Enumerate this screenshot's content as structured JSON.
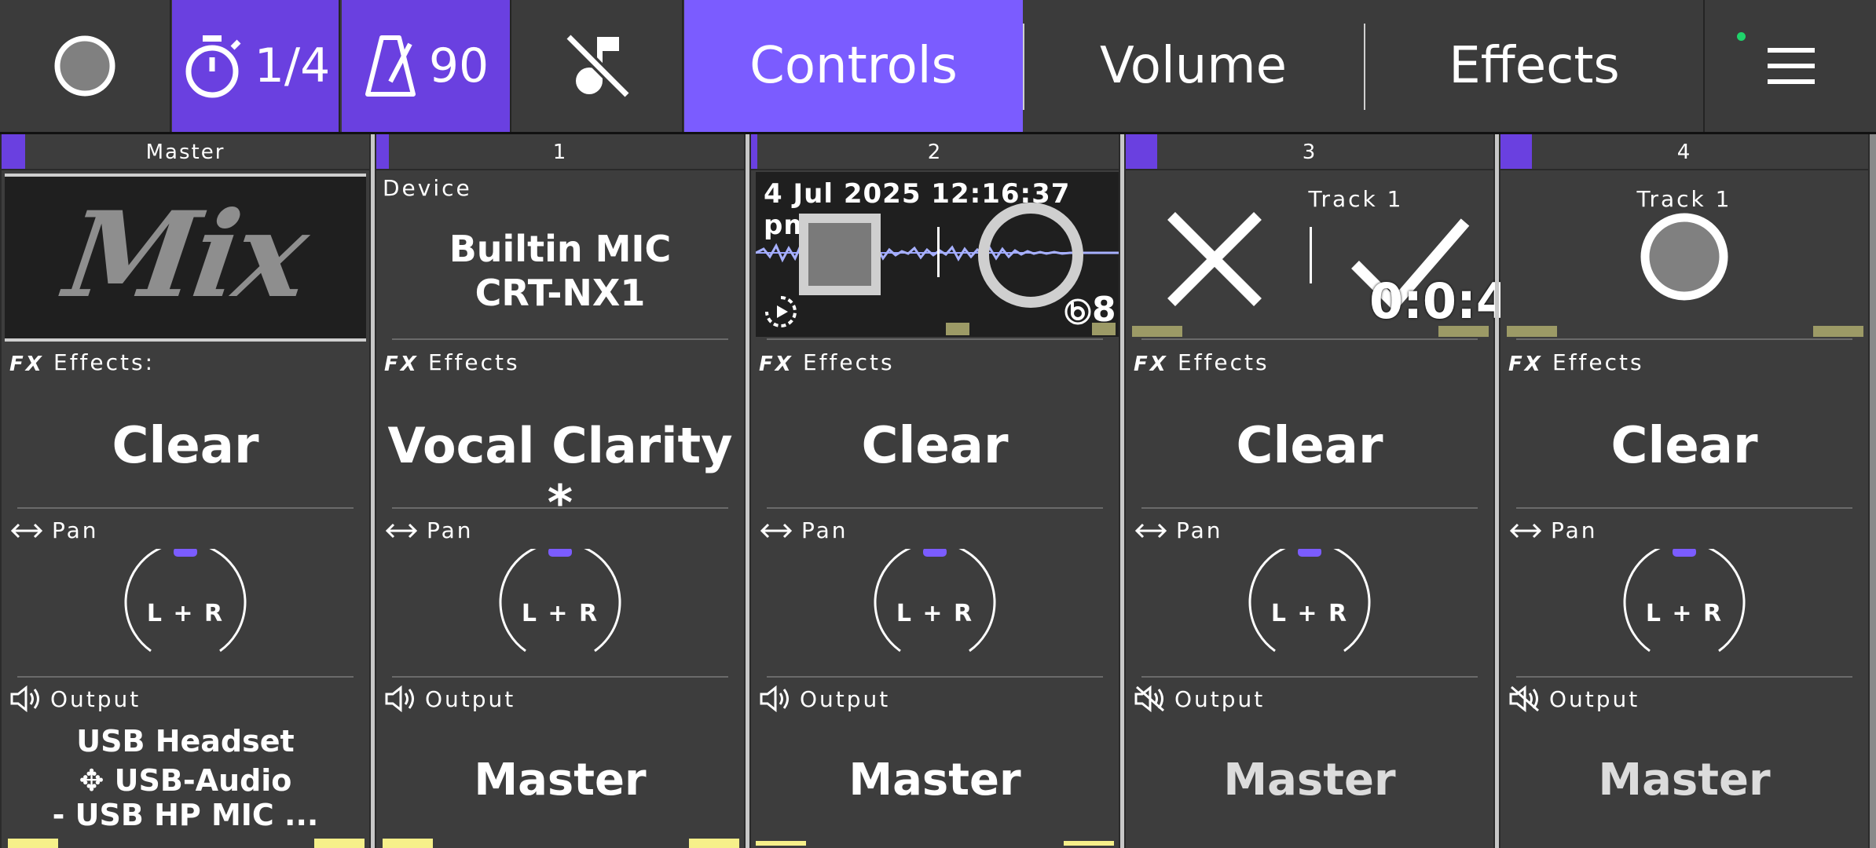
{
  "topbar": {
    "record_icon": "record-circle-icon",
    "timer_icon": "stopwatch-icon",
    "timer_value": "1/4",
    "metronome_icon": "metronome-icon",
    "tempo_value": "90",
    "mute_music_icon": "music-off-icon",
    "tabs": [
      {
        "label": "Controls"
      },
      {
        "label": "Volume"
      },
      {
        "label": "Effects"
      }
    ],
    "menu_icon": "hamburger-menu-icon",
    "status_dot_color": "#1fd36b"
  },
  "colors": {
    "accent": "#7b5cff",
    "accent_dark": "#6a40e0",
    "meter_yellow": "#f6f08a",
    "meter_olive": "#9c9a66",
    "knob_indicator": "#7b5cff"
  },
  "strips": [
    {
      "number": "Master",
      "top": {
        "type": "mix",
        "text": "Mix"
      },
      "effects_label": "Effects:",
      "effects_value": "Clear",
      "pan_label": "Pan",
      "pan_value": "L + R",
      "output_label": "Output",
      "output_lines": [
        "USB Headset",
        "✥ USB-Audio",
        "- USB HP MIC ..."
      ],
      "output_muted": false
    },
    {
      "number": "1",
      "top": {
        "type": "device",
        "caption": "Device",
        "line1": "Builtin MIC",
        "line2": "CRT-NX1"
      },
      "effects_label": "Effects",
      "effects_value": "Vocal Clarity *",
      "pan_label": "Pan",
      "pan_value": "L + R",
      "output_label": "Output",
      "output_value": "Master",
      "output_muted": false
    },
    {
      "number": "2",
      "top": {
        "type": "recording",
        "timestamp": "4 Jul 2025 12:16:37 pm",
        "count": "8"
      },
      "effects_label": "Effects",
      "effects_value": "Clear",
      "pan_label": "Pan",
      "pan_value": "L + R",
      "output_label": "Output",
      "output_value": "Master",
      "output_muted": false
    },
    {
      "number": "3",
      "top": {
        "type": "confirm",
        "track": "Track 1",
        "time": "0:0:4"
      },
      "effects_label": "Effects",
      "effects_value": "Clear",
      "pan_label": "Pan",
      "pan_value": "L + R",
      "output_label": "Output",
      "output_value": "Master",
      "output_muted": true
    },
    {
      "number": "4",
      "top": {
        "type": "record",
        "track": "Track 1"
      },
      "effects_label": "Effects",
      "effects_value": "Clear",
      "pan_label": "Pan",
      "pan_value": "L + R",
      "output_label": "Output",
      "output_value": "Master",
      "output_muted": true
    }
  ]
}
